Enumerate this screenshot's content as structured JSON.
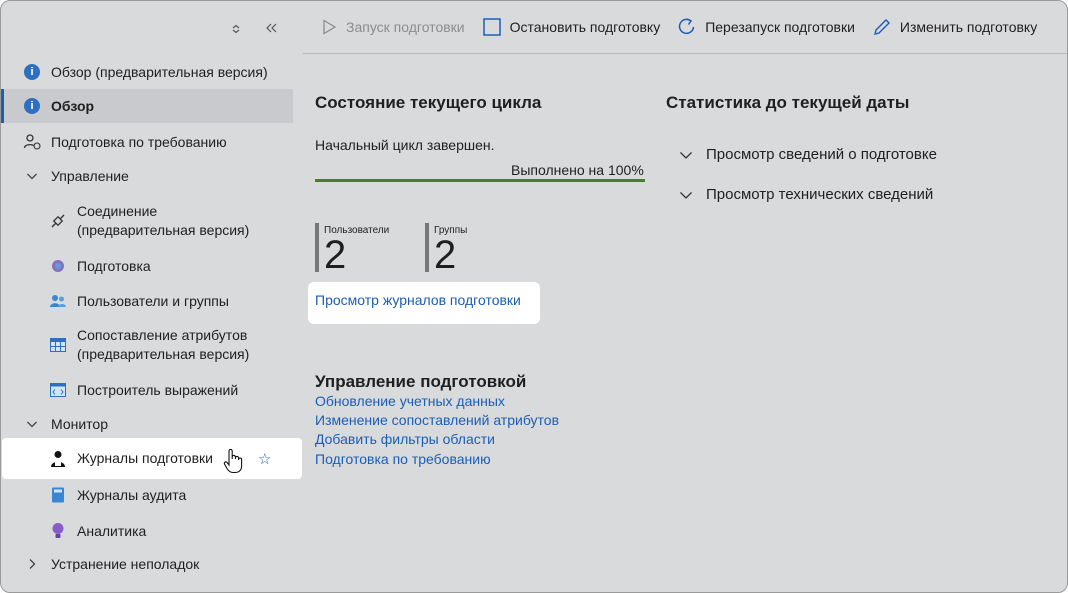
{
  "sidebar": {
    "items": [
      {
        "label": "Обзор (предварительная версия)"
      },
      {
        "label": "Обзор"
      },
      {
        "label": "Подготовка по требованию"
      },
      {
        "label": "Управление"
      },
      {
        "label": "Соединение (предварительная версия)"
      },
      {
        "label": "Подготовка"
      },
      {
        "label": "Пользователи и группы"
      },
      {
        "label": "Сопоставление атрибутов (предварительная версия)"
      },
      {
        "label": "Построитель выражений"
      },
      {
        "label": "Монитор"
      },
      {
        "label": "Журналы подготовки"
      },
      {
        "label": "Журналы аудита"
      },
      {
        "label": "Аналитика"
      },
      {
        "label": "Устранение неполадок"
      }
    ],
    "connection_line1": "Соединение",
    "connection_line2": "(предварительная версия)",
    "attr_line1": "Сопоставление атрибутов",
    "attr_line2": "(предварительная версия)"
  },
  "toolbar": {
    "start": "Запуск подготовки",
    "stop": "Остановить подготовку",
    "restart": "Перезапуск подготовки",
    "edit": "Изменить подготовку"
  },
  "cycle": {
    "title": "Состояние текущего цикла",
    "status": "Начальный цикл завершен.",
    "progress_label": "Выполнено на 100%",
    "progress_value": 100
  },
  "stats": {
    "users_caption": "Пользователи",
    "users_value": "2",
    "groups_caption": "Группы",
    "groups_value": "2",
    "logs_link": "Просмотр журналов подготовки"
  },
  "manage": {
    "title": "Управление подготовкой",
    "links": [
      "Обновление учетных данных",
      "Изменение сопоставлений атрибутов",
      "Добавить фильтры области",
      "Подготовка по требованию"
    ]
  },
  "to_date": {
    "title": "Статистика до текущей даты",
    "expand1": "Просмотр сведений о подготовке",
    "expand2": "Просмотр технических сведений"
  },
  "colors": {
    "accent": "#1a5fb4",
    "progress": "#4d7d2b",
    "background": "#d9dadc"
  }
}
